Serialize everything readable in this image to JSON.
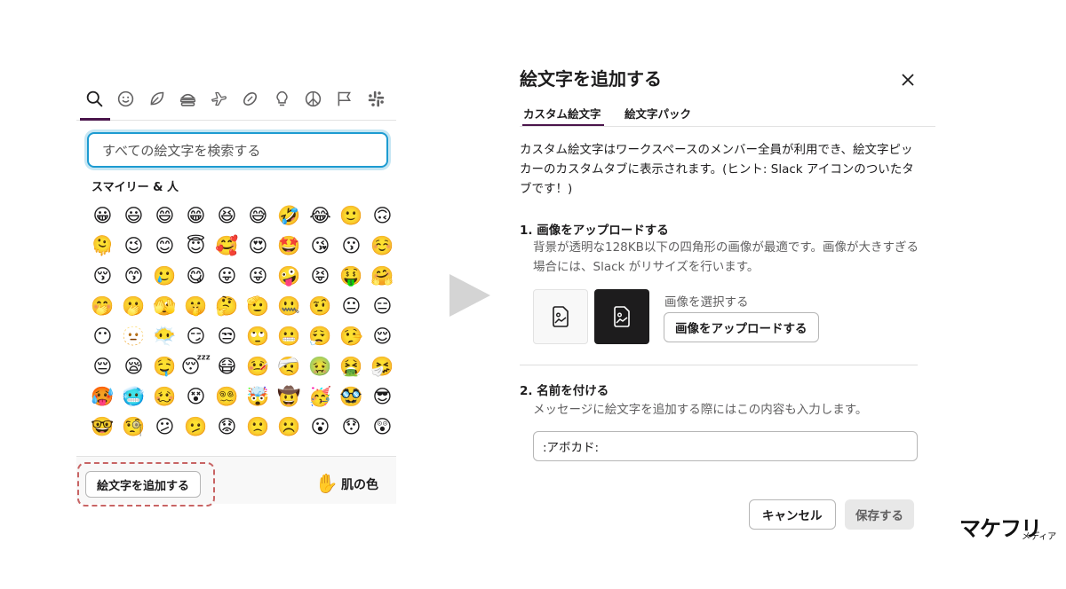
{
  "picker": {
    "categories": [
      {
        "name": "search-icon"
      },
      {
        "name": "smiley-icon"
      },
      {
        "name": "leaf-icon"
      },
      {
        "name": "burger-icon"
      },
      {
        "name": "airplane-icon"
      },
      {
        "name": "ball-icon"
      },
      {
        "name": "lightbulb-icon"
      },
      {
        "name": "peace-icon"
      },
      {
        "name": "flag-icon"
      },
      {
        "name": "slack-icon"
      }
    ],
    "search_placeholder": "すべての絵文字を検索する",
    "section_title": "スマイリー & 人",
    "emojis": [
      "😀",
      "😃",
      "😄",
      "😁",
      "😆",
      "😅",
      "🤣",
      "😂",
      "🙂",
      "🙃",
      "🫠",
      "😉",
      "😊",
      "😇",
      "🥰",
      "😍",
      "🤩",
      "😘",
      "😗",
      "☺️",
      "😚",
      "😙",
      "🥲",
      "😋",
      "😛",
      "😜",
      "🤪",
      "😝",
      "🤑",
      "🤗",
      "🤭",
      "🫢",
      "🫣",
      "🤫",
      "🤔",
      "🫡",
      "🤐",
      "🤨",
      "😐",
      "😑",
      "😶",
      "🫥",
      "😶‍🌫️",
      "😏",
      "😒",
      "🙄",
      "😬",
      "😮‍💨",
      "🤥",
      "😌",
      "😔",
      "😪",
      "🤤",
      "😴",
      "😷",
      "🤒",
      "🤕",
      "🤢",
      "🤮",
      "🤧",
      "🥵",
      "🥶",
      "🥴",
      "😵",
      "😵‍💫",
      "🤯",
      "🤠",
      "🥳",
      "🥸",
      "😎",
      "🤓",
      "🧐",
      "😕",
      "🫤",
      "😟",
      "🙁",
      "☹️",
      "😮",
      "😯",
      "😲"
    ],
    "add_emoji_label": "絵文字を追加する",
    "skin_hand": "✋",
    "skin_label": "肌の色"
  },
  "modal": {
    "title": "絵文字を追加する",
    "tabs": [
      {
        "label": "カスタム絵文字"
      },
      {
        "label": "絵文字パック"
      }
    ],
    "description": "カスタム絵文字はワークスペースのメンバー全員が利用でき、絵文字ピッカーのカスタムタブに表示されます。(ヒント: Slack アイコンのついたタブです！)",
    "step1_title": "1. 画像をアップロードする",
    "step1_text": "背景が透明な128KB以下の四角形の画像が最適です。画像が大きすぎる場合には、Slack がリサイズを行います。",
    "choose_image_label": "画像を選択する",
    "upload_button": "画像をアップロードする",
    "step2_title": "2. 名前を付ける",
    "step2_text": "メッセージに絵文字を追加する際にはこの内容も入力します。",
    "name_value": ":アボカド:",
    "cancel_button": "キャンセル",
    "save_button": "保存する"
  },
  "watermark": {
    "brand": "マケフリ",
    "sub": "メディア"
  }
}
